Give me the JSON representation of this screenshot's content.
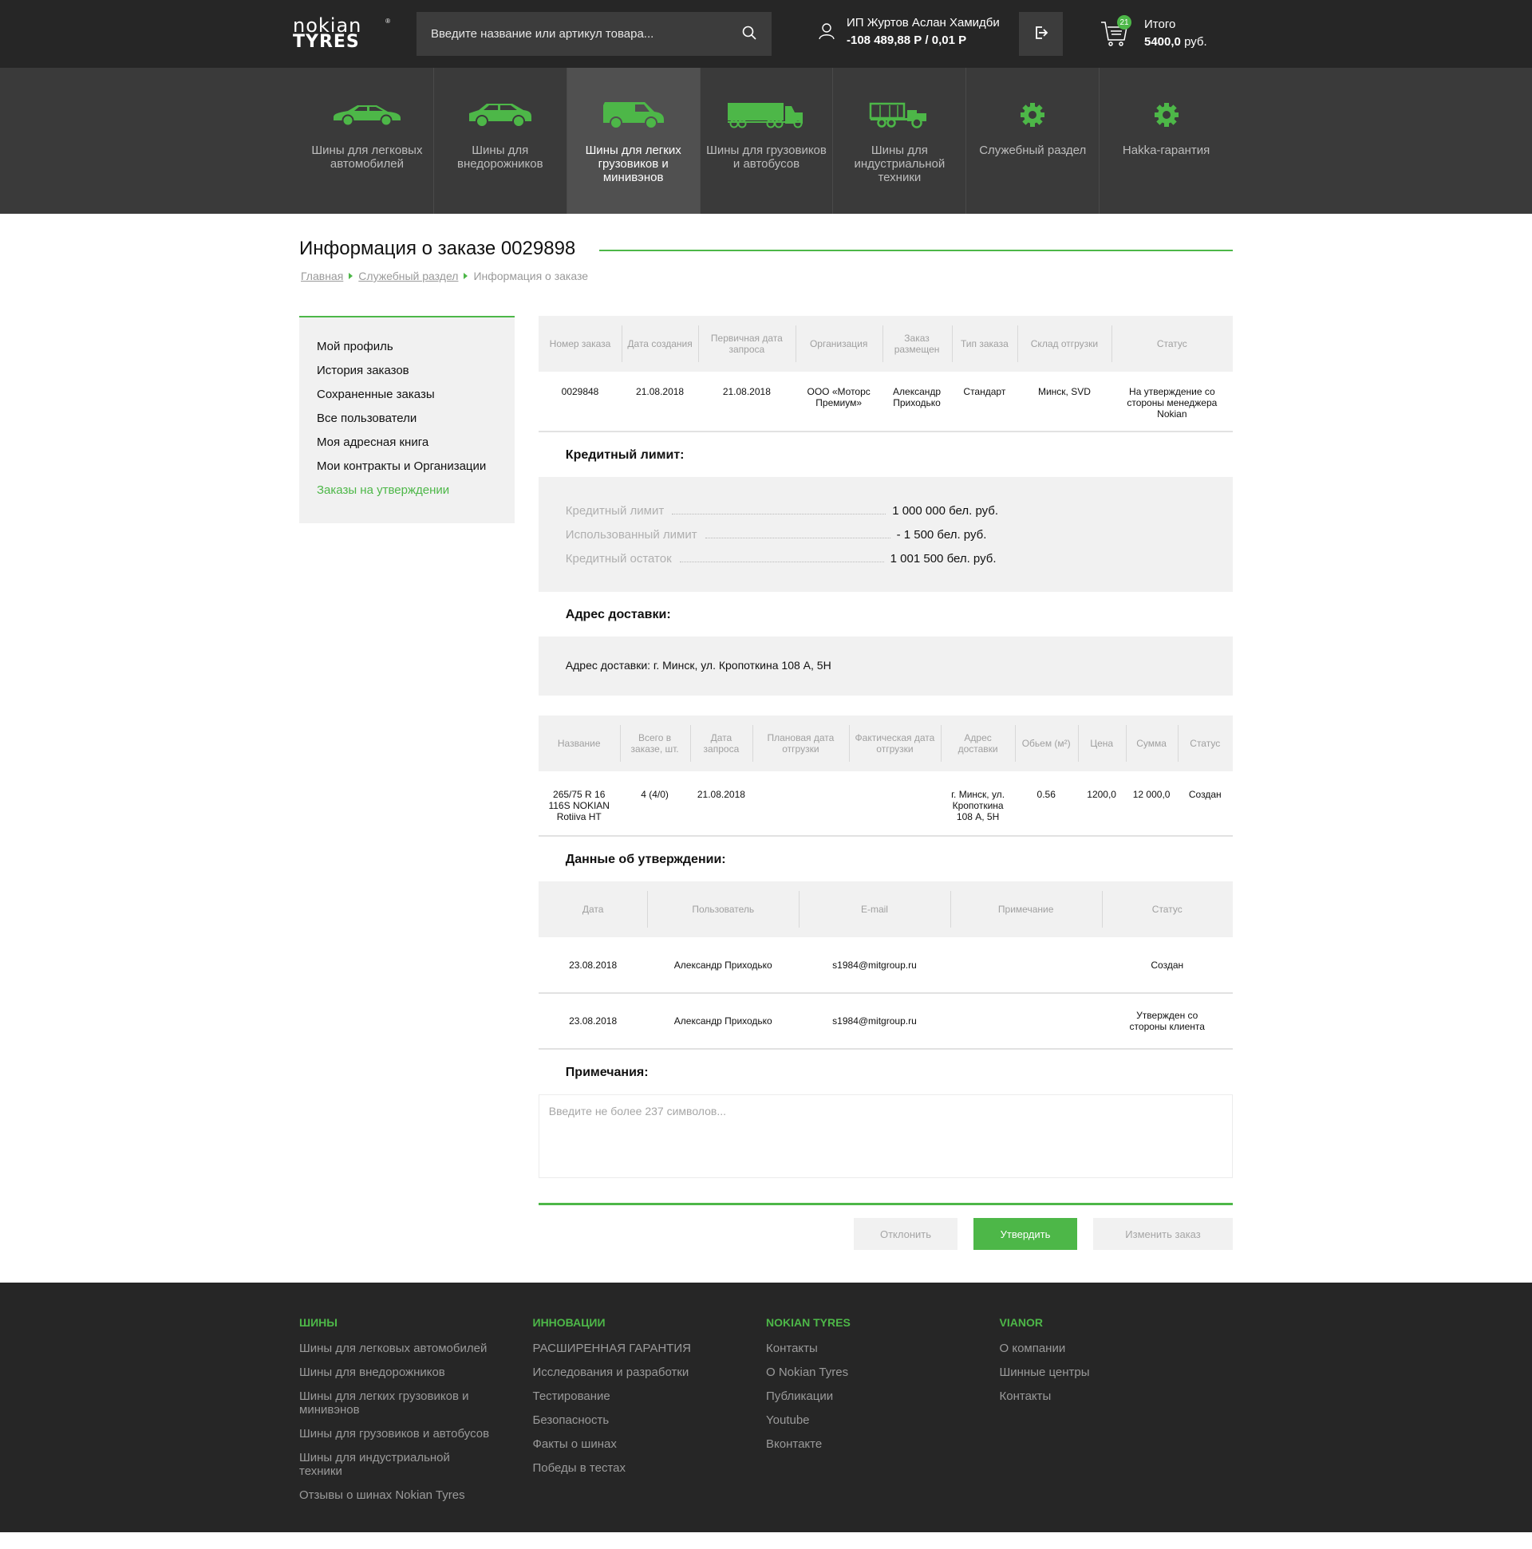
{
  "header": {
    "logo_line1": "nokian",
    "logo_line2": "TYRES",
    "logo_reg": "®",
    "search_placeholder": "Введите название или артикул товара...",
    "user_name": "ИП Журтов Аслан Хамидби",
    "user_balance": "-108 489,88 Р / 0,01 Р",
    "cart_count": "21",
    "cart_label": "Итого",
    "cart_total": "5400,0",
    "cart_currency": "руб."
  },
  "categories": [
    {
      "label": "Шины для легковых автомобилей",
      "icon": "car-icon"
    },
    {
      "label": "Шины для внедорожников",
      "icon": "suv-icon"
    },
    {
      "label": "Шины для легких грузовиков и минивэнов",
      "icon": "van-icon",
      "active": true
    },
    {
      "label": "Шины для грузовиков и автобусов",
      "icon": "truck-icon"
    },
    {
      "label": "Шины для индустриальной техники",
      "icon": "industrial-truck-icon"
    },
    {
      "label": "Служебный раздел",
      "icon": "gear-icon"
    },
    {
      "label": "Hakka-гарантия",
      "icon": "gear-icon"
    }
  ],
  "page": {
    "title": "Информация о заказе 0029898",
    "breadcrumbs": [
      "Главная",
      "Служебный раздел",
      "Информация о заказе"
    ]
  },
  "sidebar": {
    "items": [
      {
        "label": "Мой профиль"
      },
      {
        "label": "История заказов"
      },
      {
        "label": "Сохраненные заказы"
      },
      {
        "label": "Все пользователи"
      },
      {
        "label": "Моя адресная книга"
      },
      {
        "label": "Мои контракты и Организации"
      },
      {
        "label": "Заказы на утверждении",
        "active": true
      }
    ]
  },
  "order_table": {
    "headers": [
      "Номер заказа",
      "Дата создания",
      "Первичная дата запроса",
      "Организация",
      "Заказ размещен",
      "Тип заказа",
      "Склад отгрузки",
      "Статус"
    ],
    "row": [
      "0029848",
      "21.08.2018",
      "21.08.2018",
      "ООО «Моторс Премиум»",
      "Александр Приходько",
      "Стандарт",
      "Минск, SVD",
      "На утверждение со стороны менеджера Nokian"
    ]
  },
  "credit": {
    "title": "Кредитный лимит:",
    "rows": [
      {
        "label": "Кредитный лимит",
        "value": "1 000 000 бел. руб."
      },
      {
        "label": "Использованный лимит",
        "value": "- 1 500 бел. руб."
      },
      {
        "label": "Кредитный остаток",
        "value": "1 001 500 бел. руб."
      }
    ]
  },
  "delivery": {
    "title": "Адрес доставки:",
    "text": "Адрес доставки: г. Минск, ул. Кропоткина 108 А, 5Н"
  },
  "items_table": {
    "headers": [
      "Название",
      "Всего в заказе, шт.",
      "Дата запроса",
      "Плановая дата отгрузки",
      "Фактическая дата отгрузки",
      "Адрес доставки",
      "Обьем (м²)",
      "Цена",
      "Сумма",
      "Статус"
    ],
    "rows": [
      [
        "265/75 R 16 116S NOKIAN Rotiiva HT",
        "4 (4/0)",
        "21.08.2018",
        "",
        "",
        "г. Минск, ул. Кропоткина 108 А, 5Н",
        "0.56",
        "1200,0",
        "12 000,0",
        "Создан"
      ]
    ]
  },
  "approval": {
    "title": "Данные об утверждении:",
    "headers": [
      "Дата",
      "Пользователь",
      "E-mail",
      "Примечание",
      "Статус"
    ],
    "rows": [
      [
        "23.08.2018",
        "Александр Приходько",
        "s1984@mitgroup.ru",
        "",
        "Создан"
      ],
      [
        "23.08.2018",
        "Александр Приходько",
        "s1984@mitgroup.ru",
        "",
        "Утвержден со стороны клиента"
      ]
    ]
  },
  "notes": {
    "title": "Примечания:",
    "placeholder": "Введите не более 237 символов...",
    "value": ""
  },
  "actions": {
    "reject": "Отклонить",
    "approve": "Утвердить",
    "edit": "Изменить заказ"
  },
  "footer": {
    "columns": [
      {
        "title": "ШИНЫ",
        "links": [
          "Шины для легковых автомобилей",
          "Шины для внедорожников",
          "Шины для легких грузовиков и минивэнов",
          "Шины для грузовиков и автобусов",
          "Шины для индустриальной техники",
          "Отзывы о шинах Nokian Tyres"
        ]
      },
      {
        "title": "ИННОВАЦИИ",
        "links": [
          "РАСШИРЕННАЯ ГАРАНТИЯ",
          "Исследования и разработки",
          "Тестирование",
          "Безопасность",
          "Факты о шинах",
          "Победы в тестах"
        ]
      },
      {
        "title": "NOKIAN TYRES",
        "links": [
          "Контакты",
          "О Nokian Tyres",
          "Публикации",
          "Youtube",
          "Вконтакте"
        ]
      },
      {
        "title": "VIANOR",
        "links": [
          "О компании",
          "Шинные центры",
          "Контакты"
        ]
      }
    ]
  },
  "colors": {
    "accent": "#4db748",
    "header_bg": "#262626",
    "nav_bg": "#3a3a3a",
    "nav_active_bg": "#505050",
    "panel_bg": "#f1f1f1"
  }
}
